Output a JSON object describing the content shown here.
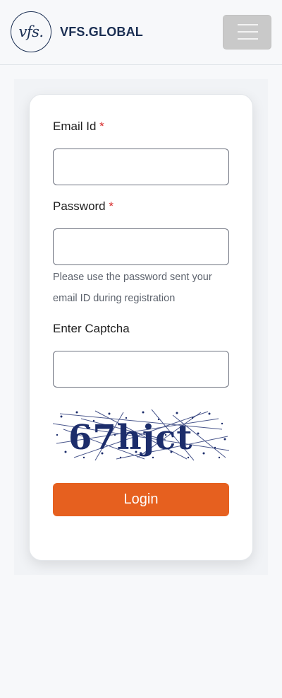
{
  "header": {
    "logo_mark": "vfs.",
    "logo_text": "VFS.GLOBAL",
    "menu_icon": "hamburger-menu-icon"
  },
  "form": {
    "email_label": "Email Id",
    "email_required": "*",
    "email_value": "",
    "password_label": "Password",
    "password_required": "*",
    "password_value": "",
    "password_hint": "Please use the password sent your email ID during registration",
    "captcha_label": "Enter Captcha",
    "captcha_value": "",
    "captcha_text": "67hjct",
    "login_label": "Login"
  },
  "colors": {
    "brand_navy": "#1b2f53",
    "accent_orange": "#e6601f",
    "required_red": "#d62b2b",
    "captcha_ink": "#1c2d6b"
  }
}
